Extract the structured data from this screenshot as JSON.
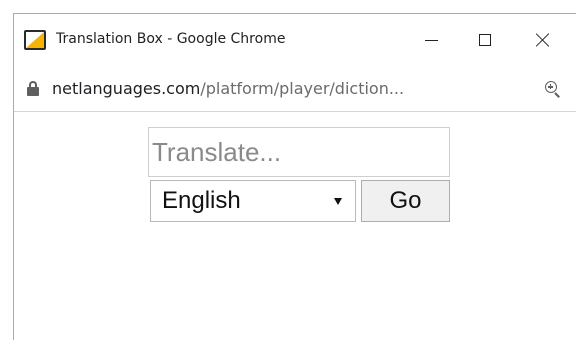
{
  "window": {
    "title": "Translation Box - Google Chrome",
    "controls": {
      "minimize": "—",
      "maximize": "☐",
      "close": "✕"
    }
  },
  "address_bar": {
    "url_host": "netlanguages.com",
    "url_path": "/platform/player/diction..."
  },
  "translator": {
    "input_value": "",
    "input_placeholder": "Translate...",
    "language_selected": "English",
    "go_label": "Go"
  },
  "icons": {
    "favicon": "netlanguages-favicon",
    "lock": "lock-icon",
    "zoom": "zoom-in-icon"
  },
  "colors": {
    "favicon_accent": "#f6b400",
    "url_path": "#6b6b6b",
    "placeholder": "#8a8a8a",
    "button_bg": "#f0f0f0"
  }
}
